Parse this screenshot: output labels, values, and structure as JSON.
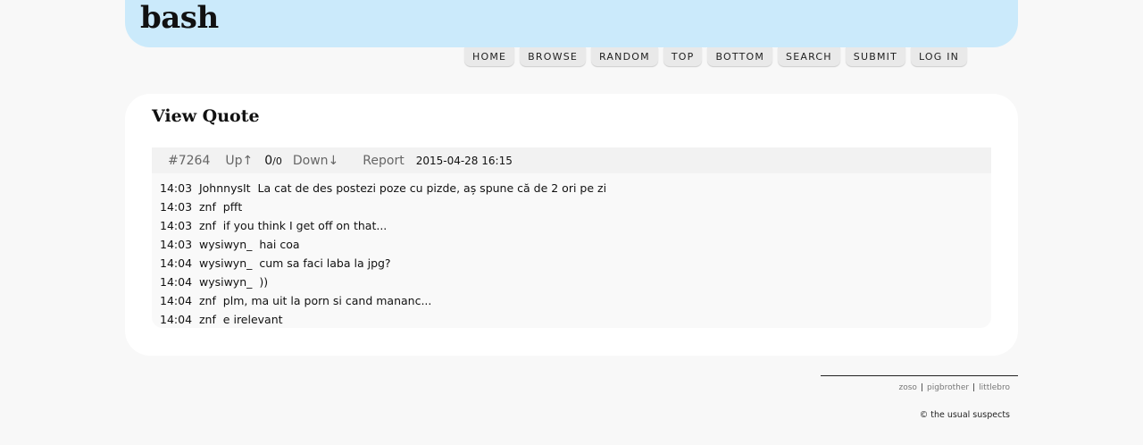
{
  "site": {
    "title": "bash"
  },
  "nav": [
    {
      "label": "HOME"
    },
    {
      "label": "BROWSE"
    },
    {
      "label": "RANDOM"
    },
    {
      "label": "TOP"
    },
    {
      "label": "BOTTOM"
    },
    {
      "label": "SEARCH"
    },
    {
      "label": "SUBMIT"
    },
    {
      "label": "LOG IN"
    }
  ],
  "page": {
    "title": "View Quote"
  },
  "quote": {
    "id": "#7264",
    "up_label": "Up↑",
    "score": "0",
    "votes": "/0",
    "down_label": "Down↓",
    "report_label": "Report",
    "date": "2015-04-28 16:15",
    "lines": [
      "14:03  JohnnysIt  La cat de des postezi poze cu pizde, aș spune că de 2 ori pe zi",
      "14:03  znf  pfft",
      "14:03  znf  if you think I get off on that...",
      "14:03  wysiwyn_  hai coa",
      "14:04  wysiwyn_  cum sa faci laba la jpg?",
      "14:04  wysiwyn_  ))",
      "14:04  znf  plm, ma uit la porn si cand mananc...",
      "14:04  znf  e irelevant"
    ]
  },
  "footer": {
    "links": [
      "zoso",
      "pigbrother",
      "littlebro"
    ],
    "copyright": "© the usual suspects"
  }
}
